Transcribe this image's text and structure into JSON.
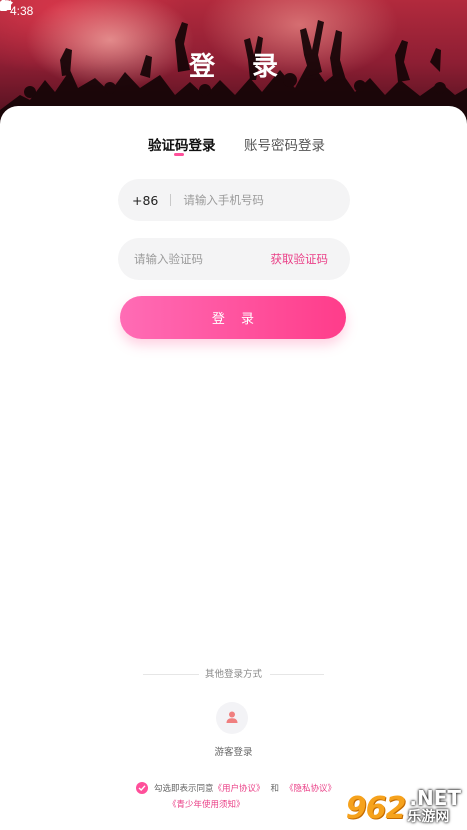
{
  "status_bar": {
    "time": "4:38",
    "left_icons": [
      "notification-icon",
      "download-icon"
    ],
    "right_icons": [
      "wifi-icon",
      "signal-icon",
      "battery-icon"
    ]
  },
  "header": {
    "title": "登 录"
  },
  "tabs": [
    {
      "label": "验证码登录",
      "active": true
    },
    {
      "label": "账号密码登录",
      "active": false
    }
  ],
  "phone_field": {
    "country_code": "+86",
    "placeholder": "请输入手机号码",
    "value": ""
  },
  "code_field": {
    "placeholder": "请输入验证码",
    "value": "",
    "get_code_label": "获取验证码"
  },
  "login_button": {
    "label": "登 录"
  },
  "other_login": {
    "divider_text": "其他登录方式",
    "guest_label": "游客登录",
    "guest_icon": "user-icon"
  },
  "agreement": {
    "checked": true,
    "prefix": "勾选即表示同意",
    "user_agreement": "《用户协议》",
    "and": "和",
    "privacy_policy": "《隐私协议》",
    "youth_notice": "《青少年使用须知》"
  },
  "watermark": {
    "number": "962",
    "domain": ".NET",
    "site": "乐游网"
  },
  "colors": {
    "accent": "#ff4f9a",
    "link": "#ea3e86",
    "button_gradient_start": "#ff6cb5",
    "button_gradient_end": "#ff3c8a",
    "field_bg": "#f4f4f5"
  }
}
